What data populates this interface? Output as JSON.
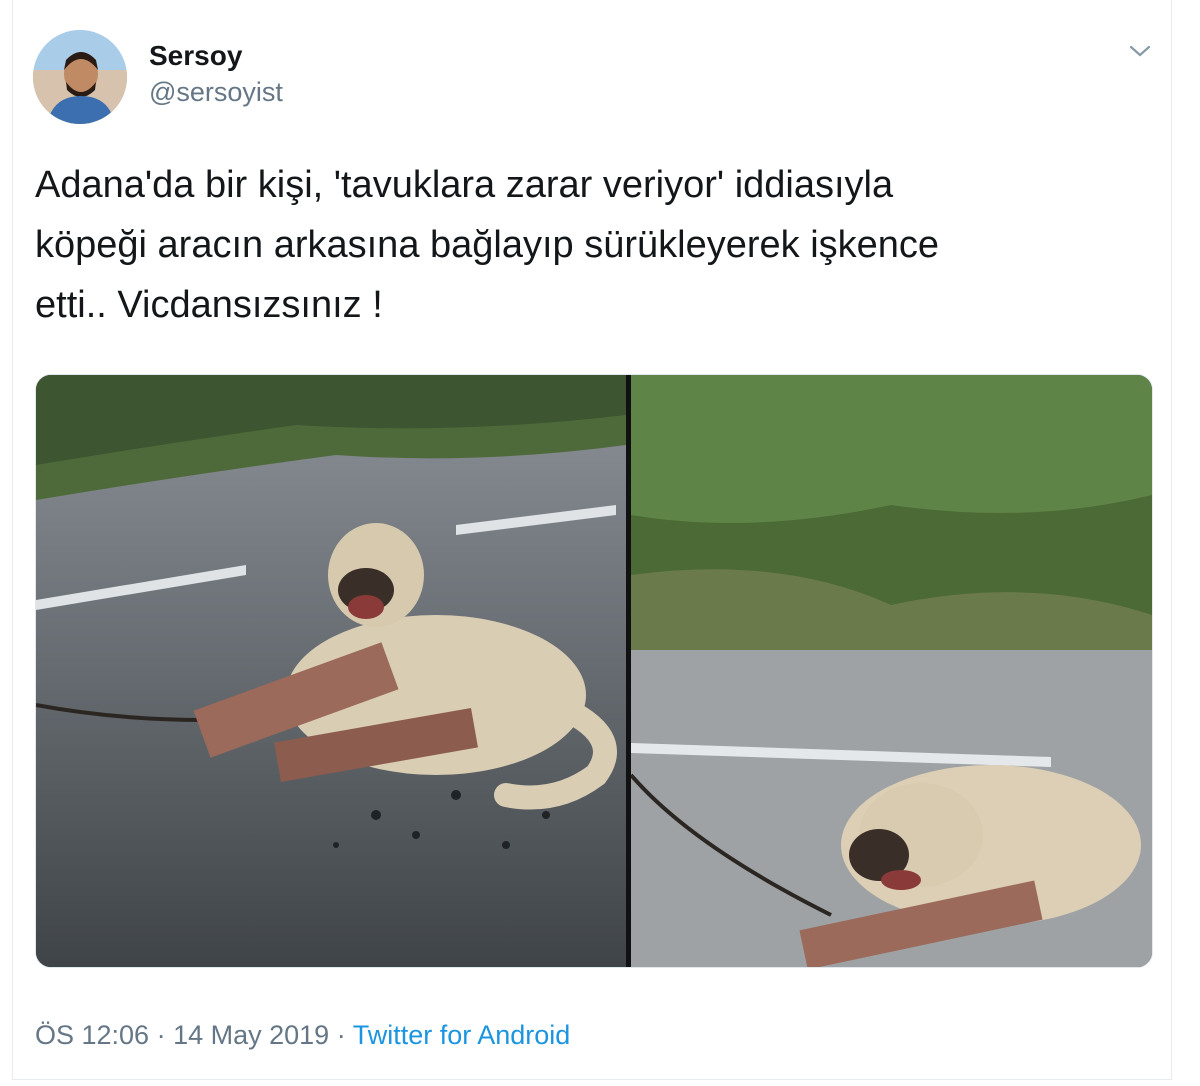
{
  "tweet": {
    "author": {
      "display_name": "Sersoy",
      "handle": "@sersoyist"
    },
    "text_lines": [
      "Adana'da bir kişi, 'tavuklara zarar veriyor' iddiasıyla",
      "köpeği aracın arkasına bağlayıp sürükleyerek işkence",
      "etti.. Vicdansızsınız !"
    ],
    "meta": {
      "time": "ÖS 12:06",
      "separator": " · ",
      "date": "14 May 2019",
      "source": "Twitter for Android"
    },
    "icons": {
      "menu": "chevron-down-icon"
    },
    "colors": {
      "text": "#14171a",
      "secondary": "#657786",
      "link": "#1b95e0"
    }
  }
}
